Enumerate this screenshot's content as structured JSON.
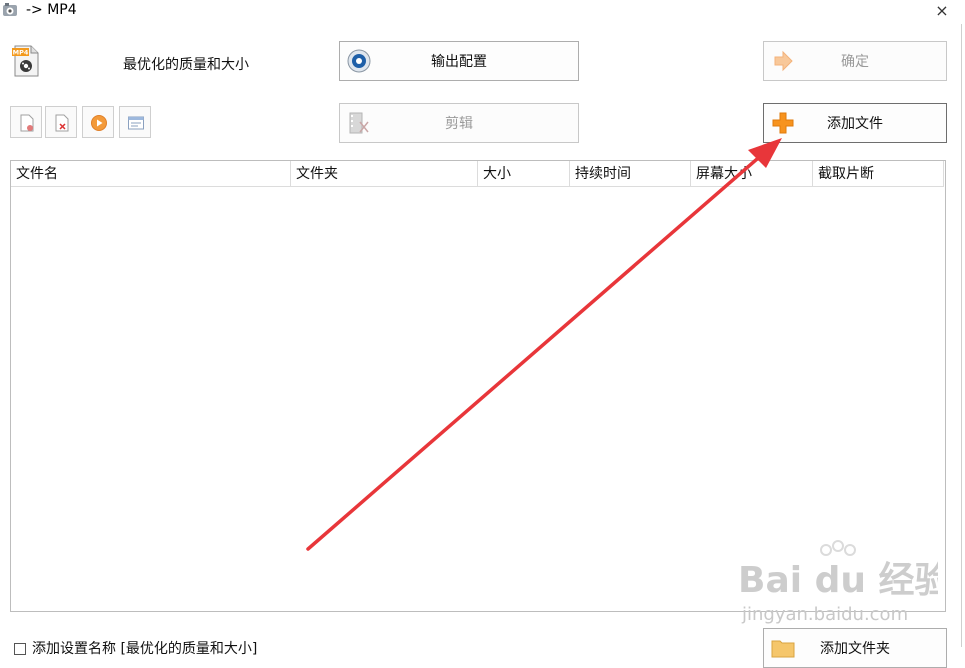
{
  "window": {
    "title": "-> MP4",
    "close_glyph": "×"
  },
  "profile": {
    "badge": "MP4",
    "label": "最优化的质量和大小"
  },
  "buttons": {
    "output_settings": "输出配置",
    "ok": "确定",
    "edit": "剪辑",
    "add_file": "添加文件",
    "add_folder": "添加文件夹"
  },
  "toolbar": {
    "items": [
      {
        "name": "remove-file-icon"
      },
      {
        "name": "clear-list-icon"
      },
      {
        "name": "play-icon"
      },
      {
        "name": "file-info-icon"
      }
    ]
  },
  "file_list": {
    "columns": [
      "文件名",
      "文件夹",
      "大小",
      "持续时间",
      "屏幕大小",
      "截取片断"
    ],
    "rows": []
  },
  "footer": {
    "checkbox_label": "添加设置名称 [最优化的质量和大小]",
    "checked": false
  },
  "watermark": {
    "brand": "Bai du 经验",
    "url": "jingyan.baidu.com"
  },
  "colors": {
    "annotation_arrow": "#e8363a",
    "add_icon": "#f7931e",
    "accent_blue": "#1e5fa8"
  }
}
